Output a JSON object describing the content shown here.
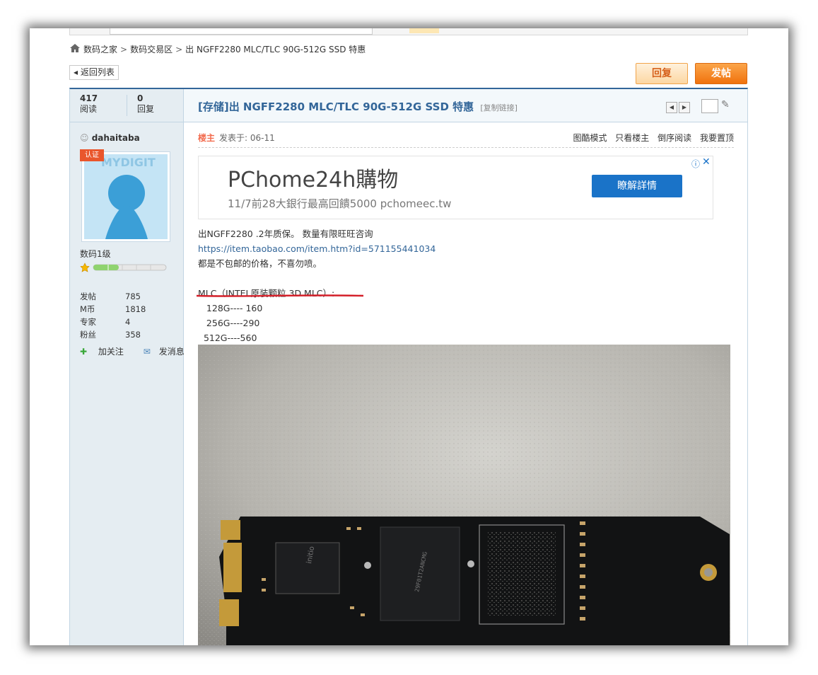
{
  "breadcrumb": {
    "items": [
      "数码之家",
      "数码交易区",
      "出 NGFF2280 MLC/TLC 90G-512G SSD 特惠"
    ],
    "separator": ">"
  },
  "buttons": {
    "back": "◂ 返回列表",
    "reply": "回复",
    "post": "发帖"
  },
  "thread": {
    "views_count": "417",
    "views_label": "阅读",
    "replies_count": "0",
    "replies_label": "回复",
    "title": "[存储]出 NGFF2280 MLC/TLC 90G-512G SSD 特惠",
    "copy_link": "[复制链接]",
    "prev_icon": "chevron-left-icon",
    "next_icon": "chevron-right-icon"
  },
  "author": {
    "name": "dahaitaba",
    "badge": "认证",
    "avatar_watermark": "MYDIGIT",
    "level": "数码1级",
    "level_progress": 0.35,
    "stats": [
      {
        "label": "发帖",
        "value": "785"
      },
      {
        "label": "M币",
        "value": "1818"
      },
      {
        "label": "专家",
        "value": "4"
      },
      {
        "label": "粉丝",
        "value": "358"
      }
    ],
    "follow": "加关注",
    "message": "发消息"
  },
  "post": {
    "op_label": "楼主",
    "time": "发表于: 06-11",
    "tools": [
      "图酷模式",
      "只看楼主",
      "倒序阅读",
      "我要置顶"
    ],
    "lines": [
      "出NGFF2280 .2年质保。 数量有限旺旺咨询",
      "https://item.taobao.com/item.htm?id=571155441034",
      "都是不包邮的价格，不喜勿喷。",
      "MLC（INTEL原装颗粒 3D MLC）:",
      "   128G---- 160",
      "   256G----290",
      "  512G----560"
    ]
  },
  "ad": {
    "title": "PChome24h購物",
    "subtitle": "11/7前28大銀行最高回饋5000 pchomeec.tw",
    "cta": "瞭解詳情",
    "info_icon": "info-icon",
    "close_icon": "close-icon"
  },
  "colors": {
    "accent_blue": "#336699",
    "op_red": "#f26c4f",
    "post_button": "#f0720d",
    "ad_button": "#1a73c8",
    "underline_red": "#d4202a"
  }
}
